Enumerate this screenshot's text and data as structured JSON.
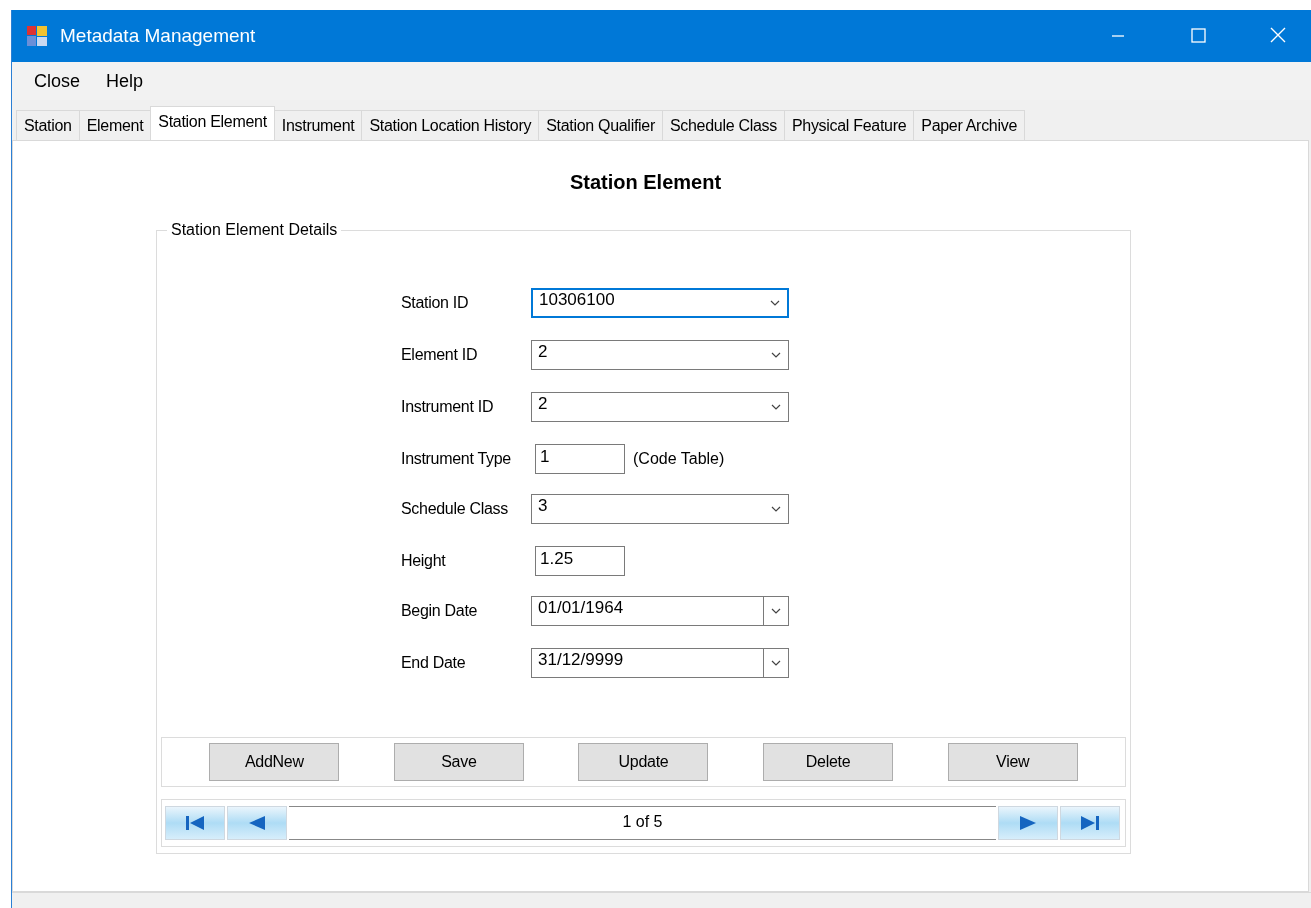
{
  "window": {
    "title": "Metadata Management"
  },
  "menu": [
    "Close",
    "Help"
  ],
  "tabs": [
    {
      "label": "Station",
      "selected": false
    },
    {
      "label": "Element",
      "selected": false
    },
    {
      "label": "Station Element",
      "selected": true
    },
    {
      "label": "Instrument",
      "selected": false
    },
    {
      "label": "Station Location History",
      "selected": false
    },
    {
      "label": "Station Qualifier",
      "selected": false
    },
    {
      "label": "Schedule Class",
      "selected": false
    },
    {
      "label": "Physical Feature",
      "selected": false
    },
    {
      "label": "Paper Archive",
      "selected": false
    }
  ],
  "heading": "Station Element",
  "group": {
    "title": "Station Element Details",
    "fields": [
      {
        "label": "Station ID",
        "kind": "combo",
        "value": "10306100",
        "focused": true
      },
      {
        "label": "Element ID",
        "kind": "combo",
        "value": "2",
        "focused": false
      },
      {
        "label": "Instrument ID",
        "kind": "combo",
        "value": "2",
        "focused": false
      },
      {
        "label": "Instrument Type",
        "kind": "text",
        "value": "1",
        "note": "(Code Table)",
        "focused": false
      },
      {
        "label": "Schedule Class",
        "kind": "combo",
        "value": "3",
        "focused": false
      },
      {
        "label": "Height",
        "kind": "text",
        "value": "1.25",
        "focused": false
      },
      {
        "label": "Begin Date",
        "kind": "date",
        "value": "01/01/1964",
        "focused": false
      },
      {
        "label": "End Date",
        "kind": "date",
        "value": "31/12/9999",
        "focused": false
      }
    ],
    "buttons": [
      "AddNew",
      "Save",
      "Update",
      "Delete",
      "View"
    ],
    "navigator": {
      "position": "1 of 5"
    }
  }
}
